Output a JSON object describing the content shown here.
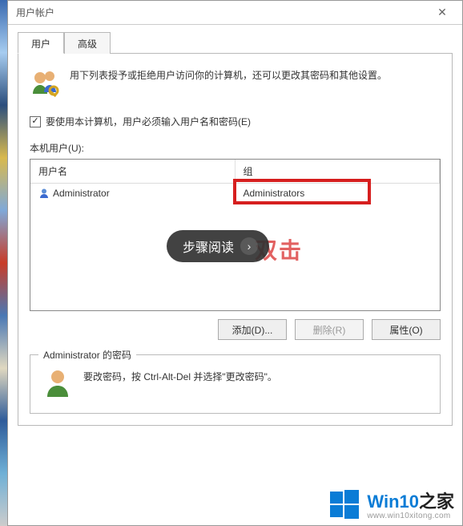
{
  "window": {
    "title": "用户帐户",
    "close_symbol": "✕"
  },
  "tabs": [
    {
      "label": "用户",
      "active": true
    },
    {
      "label": "高级",
      "active": false
    }
  ],
  "intro": {
    "text": "用下列表授予或拒绝用户访问你的计算机，还可以更改其密码和其他设置。"
  },
  "checkbox": {
    "checked": true,
    "check_glyph": "✓",
    "label": "要使用本计算机，用户必须输入用户名和密码(E)"
  },
  "list": {
    "label": "本机用户(U):",
    "columns": {
      "user": "用户名",
      "group": "组"
    },
    "rows": [
      {
        "user": "Administrator",
        "group": "Administrators"
      }
    ]
  },
  "overlay": {
    "step_label": "步骤阅读",
    "chevron": "›",
    "red_annotation": "双击"
  },
  "buttons": {
    "add": "添加(D)...",
    "remove": "删除(R)",
    "properties": "属性(O)"
  },
  "password_section": {
    "legend": "Administrator 的密码",
    "text": "要改密码，按 Ctrl-Alt-Del 并选择\"更改密码\"。"
  },
  "watermark": {
    "brand_prefix": "Win10",
    "brand_suffix": "之家",
    "url": "www.win10xitong.com"
  }
}
